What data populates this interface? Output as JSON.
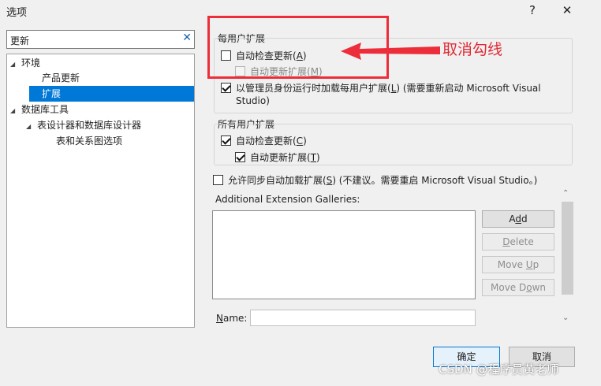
{
  "window": {
    "title": "选项",
    "help_glyph": "?",
    "close_glyph": "✕"
  },
  "search": {
    "value": "更新",
    "clear_glyph": "✕"
  },
  "tree": {
    "items": [
      {
        "label": "环境"
      },
      {
        "label": "产品更新"
      },
      {
        "label": "扩展"
      },
      {
        "label": "数据库工具"
      },
      {
        "label": "表设计器和数据库设计器"
      },
      {
        "label": "表和关系图选项"
      }
    ]
  },
  "per_user": {
    "label": "每用户扩展",
    "auto_check": {
      "label_pre": "自动检查更新(",
      "key": "A",
      "label_post": ")",
      "checked": false
    },
    "auto_update": {
      "label_pre": "自动更新扩展(",
      "key": "M",
      "label_post": ")",
      "checked": false,
      "enabled": false
    },
    "admin_load": {
      "label_pre": "以管理员身份运行时加载每用户扩展(",
      "key": "L",
      "label_post": ") (需要重新启动 Microsoft Visual",
      "line2": "Studio)",
      "checked": true
    }
  },
  "all_users": {
    "label": "所有用户扩展",
    "auto_check": {
      "label_pre": "自动检查更新(",
      "key": "C",
      "label_post": ")",
      "checked": true
    },
    "auto_update": {
      "label_pre": "自动更新扩展(",
      "key": "T",
      "label_post": ")",
      "checked": true
    }
  },
  "sync_load": {
    "label_pre": "允许同步自动加载扩展(",
    "key": "S",
    "label_post": ") (不建议。需要重启 Microsoft Visual Studio。)",
    "checked": false
  },
  "galleries": {
    "label": "Additional Extension Galleries:"
  },
  "buttons": {
    "add": {
      "pre": "A",
      "key": "d",
      "post": "d"
    },
    "delete": {
      "pre": "",
      "key": "D",
      "post": "elete"
    },
    "move_up": {
      "pre": "Move ",
      "key": "U",
      "post": "p"
    },
    "move_down": {
      "pre": "Move D",
      "key": "o",
      "post": "wn"
    }
  },
  "name_field": {
    "label_key": "N",
    "label_rest": "ame:",
    "value": ""
  },
  "footer": {
    "ok": "确定",
    "cancel": "取消"
  },
  "annotation": {
    "text": "取消勾线"
  },
  "watermark": {
    "text": "CSDN @程序员黄老师"
  },
  "colors": {
    "accent": "#0078d7",
    "annotation_red": "#ec2d3a"
  }
}
